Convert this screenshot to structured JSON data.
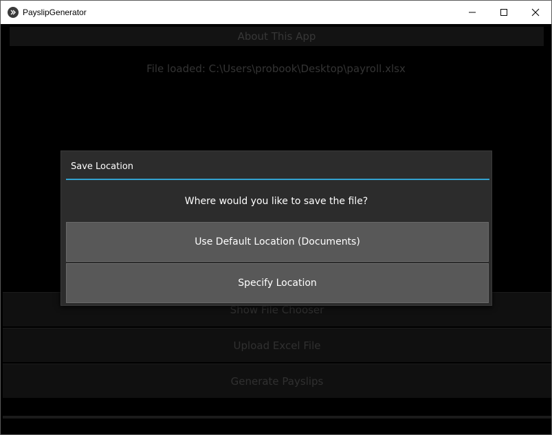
{
  "window": {
    "title": "PayslipGenerator",
    "controls": [
      "minimize-icon",
      "maximize-icon",
      "close-icon"
    ]
  },
  "main": {
    "about_label": "About This App",
    "file_loaded": "File loaded: C:\\Users\\probook\\Desktop\\payroll.xlsx",
    "buttons": [
      {
        "label": "Show File Chooser"
      },
      {
        "label": "Upload Excel File"
      },
      {
        "label": "Generate Payslips"
      }
    ]
  },
  "dialog": {
    "title": "Save Location",
    "message": "Where would you like to save the file?",
    "default_label": "Use Default Location (Documents)",
    "specify_label": "Specify Location",
    "accent": "#33a3d0"
  }
}
